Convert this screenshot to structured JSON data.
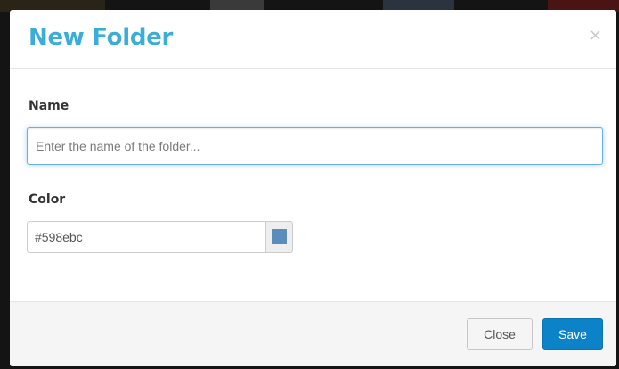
{
  "modal": {
    "title": "New Folder",
    "close_icon": "×"
  },
  "form": {
    "name": {
      "label": "Name",
      "placeholder": "Enter the name of the folder...",
      "value": ""
    },
    "color": {
      "label": "Color",
      "value": "#598ebc",
      "swatch_color": "#598ebc"
    }
  },
  "footer": {
    "close_label": "Close",
    "save_label": "Save"
  },
  "colors": {
    "title": "#3aaed6",
    "primary_button": "#0c83c8",
    "focus_border": "#66afe9"
  },
  "icons": {
    "close": "close-icon",
    "swatch": "color-swatch-icon"
  }
}
